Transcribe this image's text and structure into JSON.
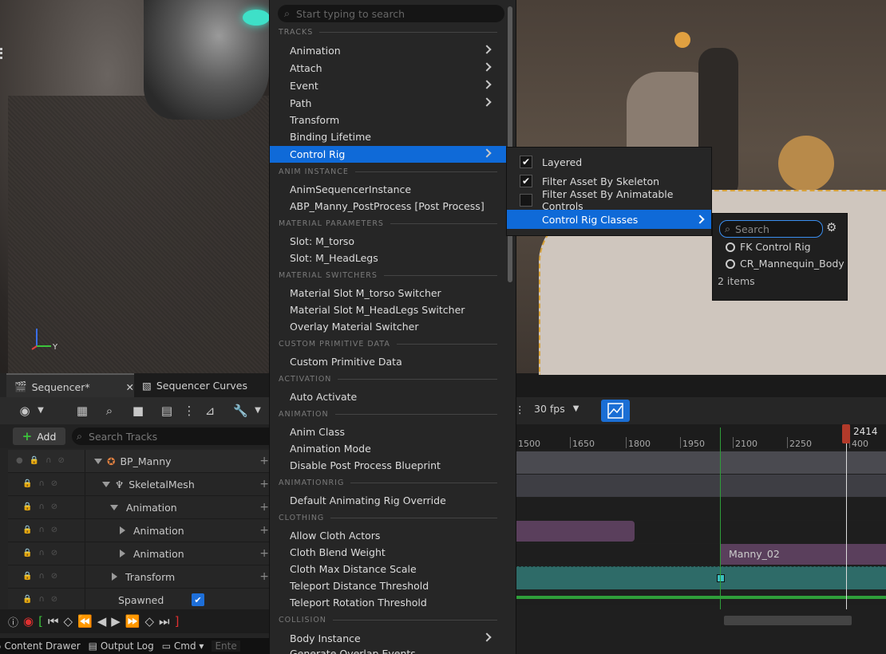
{
  "menu": {
    "search_placeholder": "Start typing to search",
    "sections": {
      "tracks": "TRACKS",
      "anim_instance": "ANIM INSTANCE",
      "material_parameters": "MATERIAL PARAMETERS",
      "material_switchers": "MATERIAL SWITCHERS",
      "custom_primitive_data": "CUSTOM PRIMITIVE DATA",
      "activation": "ACTIVATION",
      "animation": "ANIMATION",
      "animationrig": "ANIMATIONRIG",
      "clothing": "CLOTHING",
      "collision": "COLLISION"
    },
    "items": {
      "animation": "Animation",
      "attach": "Attach",
      "event": "Event",
      "path": "Path",
      "transform": "Transform",
      "binding_lifetime": "Binding Lifetime",
      "control_rig": "Control Rig",
      "anim_sequencer_instance": "AnimSequencerInstance",
      "abp_manny": "ABP_Manny_PostProcess [Post Process]",
      "slot_torso": "Slot: M_torso",
      "slot_headlegs": "Slot: M_HeadLegs",
      "switcher_torso": "Material Slot M_torso Switcher",
      "switcher_headlegs": "Material Slot M_HeadLegs Switcher",
      "overlay_switcher": "Overlay Material Switcher",
      "custom_primitive_data": "Custom Primitive Data",
      "auto_activate": "Auto Activate",
      "anim_class": "Anim Class",
      "animation_mode": "Animation Mode",
      "disable_post_process": "Disable Post Process Blueprint",
      "default_rig_override": "Default Animating Rig Override",
      "allow_cloth_actors": "Allow Cloth Actors",
      "cloth_blend_weight": "Cloth Blend Weight",
      "cloth_max_distance": "Cloth Max Distance Scale",
      "teleport_distance": "Teleport Distance Threshold",
      "teleport_rotation": "Teleport Rotation Threshold",
      "body_instance": "Body Instance",
      "generate_overlap": "Generate Overlap Events"
    }
  },
  "submenu": {
    "layered": "Layered",
    "filter_skeleton": "Filter Asset By Skeleton",
    "filter_controls": "Filter Asset By Animatable Controls",
    "classes": "Control Rig Classes",
    "layered_checked": true,
    "filter_skeleton_checked": true,
    "filter_controls_checked": false
  },
  "classes_popup": {
    "search_placeholder": "Search",
    "items": [
      "FK Control Rig",
      "CR_Mannequin_Body"
    ],
    "count": "2 items"
  },
  "sequencer": {
    "tab_label": "Sequencer*",
    "curves_tab_label": "Sequencer Curves",
    "add_label": "Add",
    "search_placeholder": "Search Tracks",
    "tracks": {
      "bp_manny": "BP_Manny",
      "skeletal_mesh": "SkeletalMesh",
      "animation": "Animation",
      "animation_sub1": "Animation",
      "animation_sub2": "Animation",
      "transform": "Transform",
      "spawned": "Spawned"
    },
    "spawned_checked": true
  },
  "timeline": {
    "fps": "30 fps",
    "ticks": [
      "1500",
      "1650",
      "1800",
      "1950",
      "2100",
      "2250",
      "400"
    ],
    "playhead": "2414",
    "clip_label": "Manny_02"
  },
  "status_bar": {
    "content_drawer": "Content Drawer",
    "output_log": "Output Log",
    "cmd": "Cmd",
    "console_placeholder": "Ente"
  },
  "colors": {
    "selection": "#0f6ad8",
    "menu_bg": "#262626",
    "clip_purple": "#5a3f5c",
    "clip_teal": "#2e6b68"
  }
}
